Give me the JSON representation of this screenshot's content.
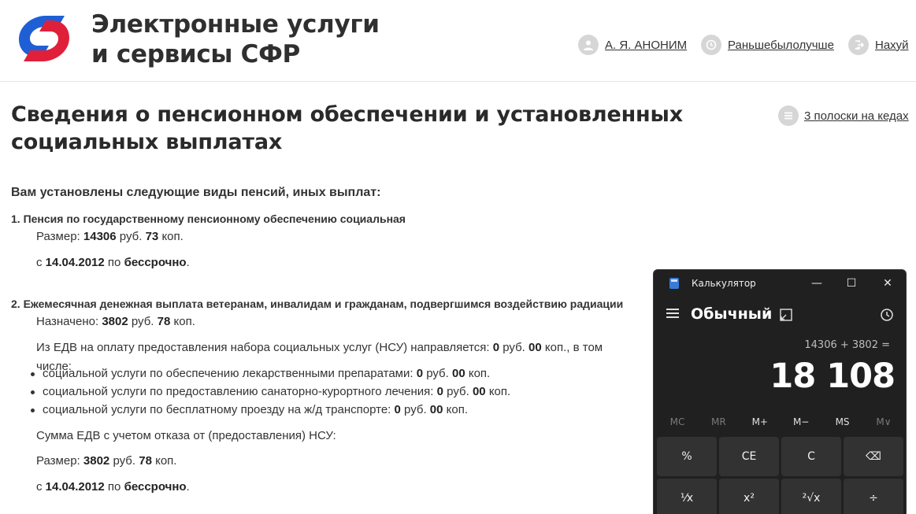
{
  "header": {
    "title_line1": "Электронные услуги",
    "title_line2": "и сервисы СФР",
    "user_name": "А. Я. АНОНИМ",
    "history_link": "Раньшебылолучше",
    "logout_link": "Нахуй"
  },
  "page": {
    "title": "Сведения о пенсионном обеспечении и установленных социальных выплатах",
    "side_link": "3 полоски на кедах",
    "intro": "Вам установлены следующие виды пенсий, иных выплат:"
  },
  "pension1": {
    "title": "1. Пенсия по государственному пенсионному обеспечению социальная",
    "size_label": "Размер:",
    "rub": "14306",
    "kop": "73",
    "from_label": "с",
    "from_date": "14.04.2012",
    "to_label": "по",
    "to_value": "бессрочно"
  },
  "pension2": {
    "title": "2. Ежемесячная денежная выплата ветеранам, инвалидам и гражданам, подвергшимся воздействию радиации",
    "assigned_label": "Назначено:",
    "rub": "3802",
    "kop": "78",
    "nsu_text": "Из ЕДВ на оплату предоставления набора социальных услуг (НСУ) направляется:",
    "nsu_rub": "0",
    "nsu_kop": "00",
    "nsu_tail": ", в том числе:",
    "items": [
      {
        "text": "социальной услуги по обеспечению лекарственными препаратами:",
        "rub": "0",
        "kop": "00"
      },
      {
        "text": "социальной услуги по предоставлению санаторно-курортного лечения:",
        "rub": "0",
        "kop": "00"
      },
      {
        "text": "социальной услуги по бесплатному проезду на ж/д транспорте:",
        "rub": "0",
        "kop": "00"
      }
    ],
    "sum_text": "Сумма ЕДВ с учетом отказа от (предоставления) НСУ:",
    "size_label": "Размер:",
    "size_rub": "3802",
    "size_kop": "78",
    "from_label": "с",
    "from_date": "14.04.2012",
    "to_label": "по",
    "to_value": "бессрочно"
  },
  "units": {
    "rub": "руб.",
    "kop": "коп."
  },
  "calculator": {
    "window_title": "Калькулятор",
    "mode": "Обычный",
    "expression": "14306 + 3802 =",
    "result": "18 108",
    "memory": [
      "MC",
      "MR",
      "M+",
      "M−",
      "MS",
      "M∨"
    ],
    "keys_row1": [
      "%",
      "CE",
      "C",
      "⌫"
    ],
    "keys_row2": [
      "⅟x",
      "x²",
      "²√x",
      "÷"
    ]
  },
  "colors": {
    "logo_blue": "#1e5fd6",
    "logo_red": "#e0203a",
    "calc_bg": "#202020",
    "calc_key": "#323232"
  }
}
